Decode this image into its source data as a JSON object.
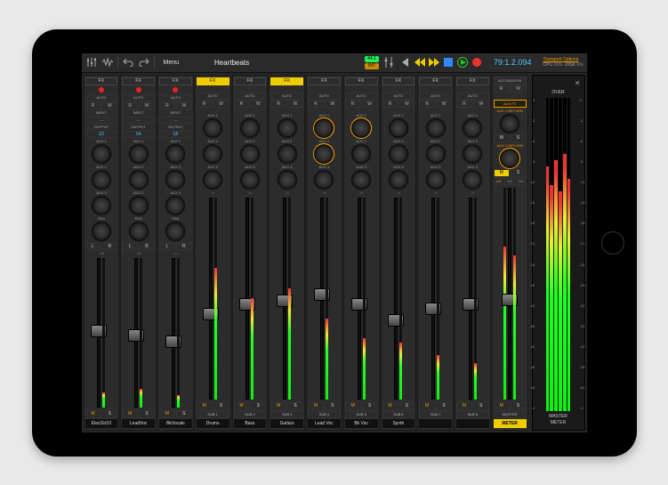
{
  "toolbar": {
    "menu_label": "Menu",
    "song_title": "Heartbeats",
    "badge1": "44.1",
    "badge2": "INT",
    "timecode": "79:1.2.094",
    "cpu_label": "CPU",
    "cpu_value": "30%",
    "disk_label": "DISK",
    "disk_value": "6%",
    "transport_options": "Transport Options"
  },
  "fx_label": "FX",
  "auto_label": "AUTO",
  "input_label": "INPUT",
  "output_label": "OUTPUT",
  "r_label": "R",
  "w_label": "W",
  "aux_labels": [
    "AUX 1",
    "AUX 2",
    "AUX 3"
  ],
  "pan_label": "PAN",
  "l_label": "L",
  "m_label": "M",
  "s_label": "S",
  "master": {
    "aux_fx": "AUX FX",
    "aux1_return": "AUX 1 RETURN",
    "aux2_return": "AUX 2 RETURN",
    "automation": "AUTOMATION",
    "pairs": [
      "1/2",
      "3/4",
      "5/6"
    ],
    "name": "MASTER",
    "meter_btn": "METER"
  },
  "meter_panel": {
    "over": "OVER",
    "label": "MASTER\nMETER",
    "scale": [
      "0",
      "-3",
      "-6",
      "-9",
      "-12",
      "-15",
      "-18",
      "-21",
      "-24",
      "-28",
      "-32",
      "-36",
      "-42",
      "-48",
      "-60",
      "-∞"
    ]
  },
  "channels": [
    {
      "type": "input",
      "name": "ElecGtr10",
      "fx_on": false,
      "rec": true,
      "output": "S3",
      "aux_active": [
        false,
        false,
        false
      ],
      "fader": 0.55,
      "meter": 0.1,
      "num": "-28"
    },
    {
      "type": "input",
      "name": "LeadVoc",
      "fx_on": false,
      "rec": true,
      "output": "S4",
      "aux_active": [
        false,
        false,
        false
      ],
      "fader": 0.52,
      "meter": 0.12,
      "num": "-29"
    },
    {
      "type": "input",
      "name": "BkVocals",
      "fx_on": false,
      "rec": true,
      "output": "S5",
      "aux_active": [
        false,
        false,
        false
      ],
      "fader": 0.48,
      "meter": 0.08,
      "num": "-∞"
    },
    {
      "type": "sub",
      "name": "Drums",
      "sub": "SUB 1",
      "fx_on": true,
      "aux_active": [
        false,
        false,
        false
      ],
      "fader": 0.45,
      "meter": 0.65,
      "num": "-∞"
    },
    {
      "type": "sub",
      "name": "Bass",
      "sub": "SUB 2",
      "fx_on": false,
      "aux_active": [
        false,
        false,
        false
      ],
      "fader": 0.5,
      "meter": 0.5,
      "num": "-∞"
    },
    {
      "type": "sub",
      "name": "Guitars",
      "sub": "SUB 3",
      "fx_on": true,
      "aux_active": [
        false,
        false,
        false
      ],
      "fader": 0.52,
      "meter": 0.55,
      "num": "-∞"
    },
    {
      "type": "sub",
      "name": "Lead Voc",
      "sub": "SUB 4",
      "fx_on": false,
      "aux_active": [
        true,
        true,
        false
      ],
      "fader": 0.55,
      "meter": 0.4,
      "num": "-∞"
    },
    {
      "type": "sub",
      "name": "Bk Voc",
      "sub": "SUB 5",
      "fx_on": false,
      "aux_active": [
        true,
        false,
        false
      ],
      "fader": 0.5,
      "meter": 0.3,
      "num": "-∞"
    },
    {
      "type": "sub",
      "name": "Synth",
      "sub": "SUB 6",
      "fx_on": false,
      "aux_active": [
        false,
        false,
        false
      ],
      "fader": 0.42,
      "meter": 0.28,
      "num": "-∞"
    },
    {
      "type": "sub",
      "name": "",
      "sub": "SUB 7",
      "fx_on": false,
      "aux_active": [
        false,
        false,
        false
      ],
      "fader": 0.48,
      "meter": 0.22,
      "num": "-∞"
    },
    {
      "type": "sub",
      "name": "",
      "sub": "SUB 8",
      "fx_on": false,
      "aux_active": [
        false,
        false,
        false
      ],
      "fader": 0.5,
      "meter": 0.18,
      "num": "-∞"
    }
  ],
  "master_strip": {
    "fader": 0.5,
    "meterL": 0.72,
    "meterR": 0.68
  },
  "big_meter_levels": [
    0.78,
    0.72,
    0.8,
    0.7,
    0.82,
    0.74
  ]
}
